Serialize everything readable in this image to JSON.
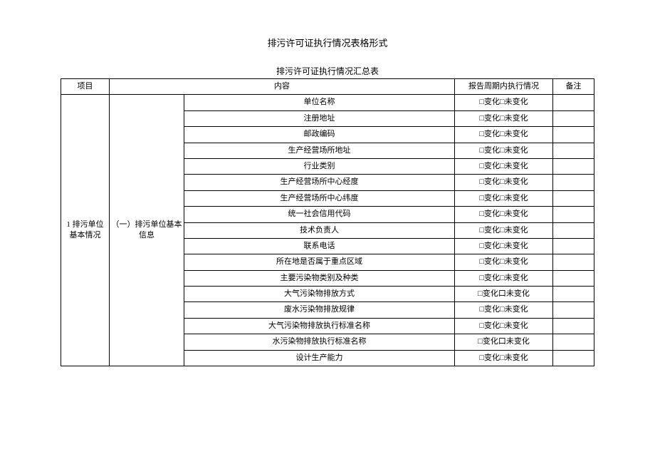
{
  "title": "排污许可证执行情况表格形式",
  "subtitle": "排污许可证执行情况汇总表",
  "headers": {
    "project": "项目",
    "content": "内容",
    "status": "报告周期内执行情况",
    "remark": "备注"
  },
  "rowgroup": {
    "project": "1 排污单位基本情况",
    "section": "（一）排污单位基本信息"
  },
  "rows": [
    {
      "content": "单位名称",
      "status": "□变化□未变化",
      "remark": ""
    },
    {
      "content": "注册地址",
      "status": "□变化□未变化",
      "remark": ""
    },
    {
      "content": "邮政编码",
      "status": "□变化□未变化",
      "remark": ""
    },
    {
      "content": "生产经营场所地址",
      "status": "□变化□未变化",
      "remark": ""
    },
    {
      "content": "行业类别",
      "status": "□变化□未变化",
      "remark": ""
    },
    {
      "content": "生产经营场所中心经度",
      "status": "□变化□未变化",
      "remark": ""
    },
    {
      "content": "生产经营场所中心纬度",
      "status": "□变化□未变化",
      "remark": ""
    },
    {
      "content": "统一社会信用代码",
      "status": "□变化□未变化",
      "remark": ""
    },
    {
      "content": "技术负责人",
      "status": "□变化□未变化",
      "remark": ""
    },
    {
      "content": "联系电话",
      "status": "□变化□未变化",
      "remark": ""
    },
    {
      "content": "所在地是否属于重点区域",
      "status": "□变化□未变化",
      "remark": ""
    },
    {
      "content": "主要污染物类别及种类",
      "status": "□变化□未变化",
      "remark": ""
    },
    {
      "content": "大气污染物排放方式",
      "status": "□变化口未变化",
      "remark": ""
    },
    {
      "content": "废水污染物排放规律",
      "status": "□变化□未变化",
      "remark": ""
    },
    {
      "content": "大气污染物排放执行标准名称",
      "status": "□变化□未变化",
      "remark": ""
    },
    {
      "content": "水污染物排放执行标准名称",
      "status": "□变化口未变化",
      "remark": ""
    },
    {
      "content": "设计生产能力",
      "status": "□变化□未变化",
      "remark": ""
    }
  ]
}
